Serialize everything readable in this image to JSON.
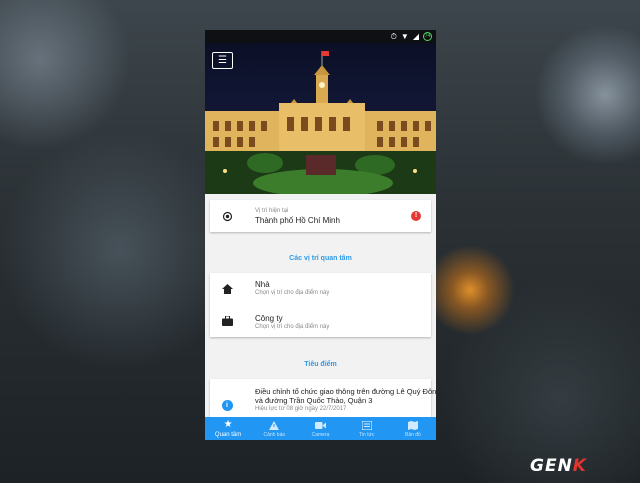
{
  "status_bar": {
    "icons": [
      "alarm-icon",
      "wifi-icon",
      "signal-icon",
      "battery-icon"
    ],
    "battery_text": "74"
  },
  "header": {
    "menu_icon": "hamburger-menu-icon",
    "hero_image": "city-hall-night-photo"
  },
  "current_location": {
    "label": "Vị trí hiện tại",
    "value": "Thành phố Hồ Chí Minh",
    "info_color": "#e53935"
  },
  "places_section": {
    "title": "Các vị trí quan tâm",
    "items": [
      {
        "icon": "home-icon",
        "title": "Nhà",
        "subtitle": "Chọn vị trí cho địa điểm này"
      },
      {
        "icon": "briefcase-icon",
        "title": "Công ty",
        "subtitle": "Chọn vị trí cho địa điểm này"
      }
    ]
  },
  "highlights_section": {
    "title": "Tiêu điểm",
    "items": [
      {
        "icon": "info-icon",
        "title_line1": "Điều chỉnh tổ chức giao thông trên đường Lê Quý Đôn",
        "title_line2": "và đường Trần Quốc Thảo, Quận 3",
        "subtitle": "Hiệu lực từ 08 giờ ngày 22/7/2017"
      }
    ]
  },
  "bottom_nav": {
    "items": [
      {
        "icon": "star-icon",
        "label": "Quan tâm",
        "active": true
      },
      {
        "icon": "warning-icon",
        "label": "Cảnh báo",
        "active": false
      },
      {
        "icon": "camera-icon",
        "label": "Camera",
        "active": false
      },
      {
        "icon": "news-icon",
        "label": "Tin tức",
        "active": false
      },
      {
        "icon": "map-icon",
        "label": "Bản đồ",
        "active": false
      }
    ]
  },
  "colors": {
    "accent": "#2196f3",
    "section_title": "#2f9be8"
  },
  "watermark": {
    "text_main": "GEN",
    "text_accent": "K"
  }
}
